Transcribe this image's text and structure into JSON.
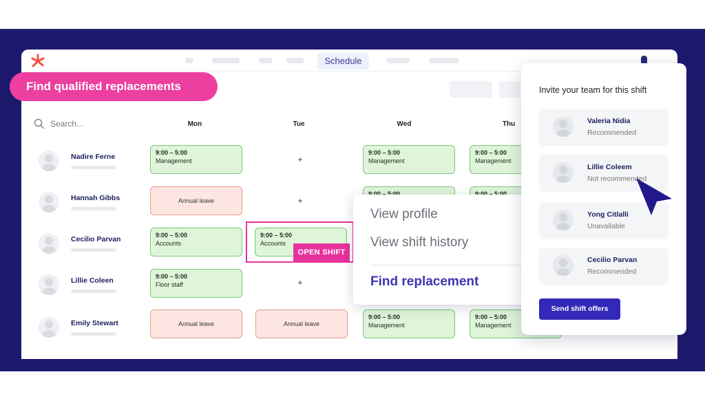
{
  "nav": {
    "active_tab": "Schedule"
  },
  "banner": {
    "text": "Find qualified replacements"
  },
  "search": {
    "placeholder": "Search..."
  },
  "days": [
    "Mon",
    "Tue",
    "Wed",
    "Thu"
  ],
  "employees": [
    {
      "name": "Nadire Ferne"
    },
    {
      "name": "Hannah Gibbs"
    },
    {
      "name": "Cecilio Parvan"
    },
    {
      "name": "Lillie Coleen"
    },
    {
      "name": "Emily Stewart"
    }
  ],
  "shifts": {
    "r0_mon": {
      "time": "9:00 – 5:00",
      "role": "Management"
    },
    "r0_wed": {
      "time": "9:00 – 5:00",
      "role": "Management"
    },
    "r0_thu": {
      "time": "9:00 – 5:00",
      "role": "Management"
    },
    "r1_mon": {
      "label": "Annual leave"
    },
    "r1_wed": {
      "time": "9:00 – 5:00"
    },
    "r1_thu": {
      "time": "9:00 – 5:00"
    },
    "r2_mon": {
      "time": "9:00 – 5:00",
      "role": "Accounts"
    },
    "r2_tue": {
      "time": "9:00 – 5:00",
      "role": "Accounts"
    },
    "r3_mon": {
      "time": "9:00 – 5:00",
      "role": "Floor staff"
    },
    "r4_mon": {
      "label": "Annual leave"
    },
    "r4_tue": {
      "label": "Annual leave"
    },
    "r4_wed": {
      "time": "9:00 – 5:00",
      "role": "Management"
    },
    "r4_thu": {
      "time": "9:00 – 5:00",
      "role": "Management"
    }
  },
  "plus_sign": "+",
  "open_shift": {
    "label": "OPEN SHIFT"
  },
  "context_menu": {
    "items": [
      "View profile",
      "View shift history"
    ],
    "primary": "Find replacement"
  },
  "invite_panel": {
    "title": "Invite your team for this shift",
    "members": [
      {
        "name": "Valeria Nidia",
        "status": "Recommended"
      },
      {
        "name": "Lillie Coleem",
        "status": "Not recommended"
      },
      {
        "name": "Yong Citlalli",
        "status": "Unavailable"
      },
      {
        "name": "Cecilio Parvan",
        "status": "Recommended"
      }
    ],
    "send_label": "Send shift offers"
  },
  "colors": {
    "frame": "#1d1a6e",
    "banner": "#ec3fa0",
    "accent": "#3328b8",
    "shift_fill": "#dff5d9",
    "leave_fill": "#fde6e1"
  }
}
